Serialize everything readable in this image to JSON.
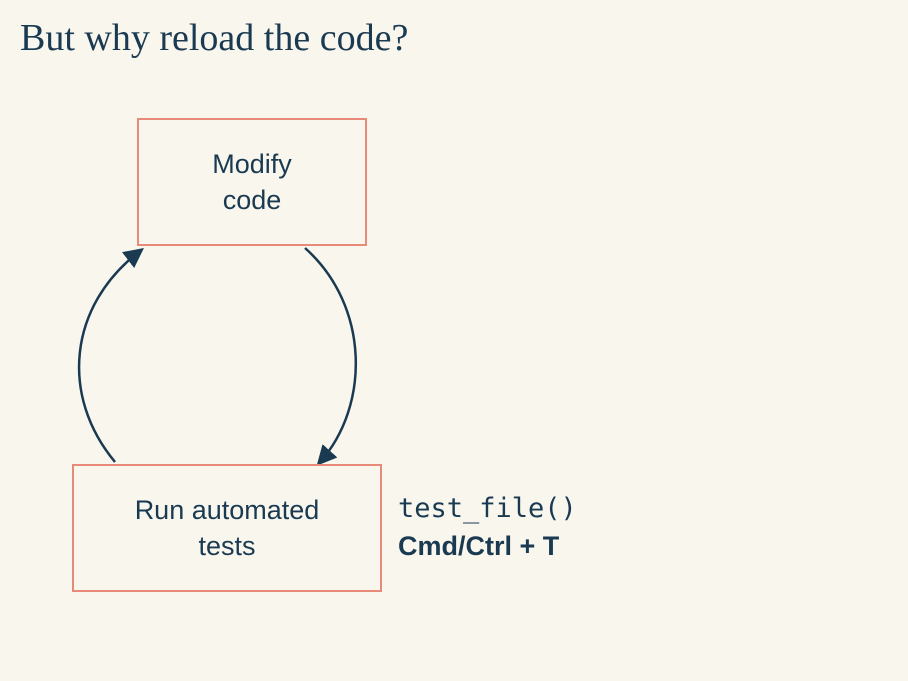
{
  "title": "But why reload the code?",
  "boxes": {
    "top": "Modify\ncode",
    "bottom": "Run automated\ntests"
  },
  "sideNote": {
    "code": "test_file()",
    "shortcut": "Cmd/Ctrl + T"
  }
}
